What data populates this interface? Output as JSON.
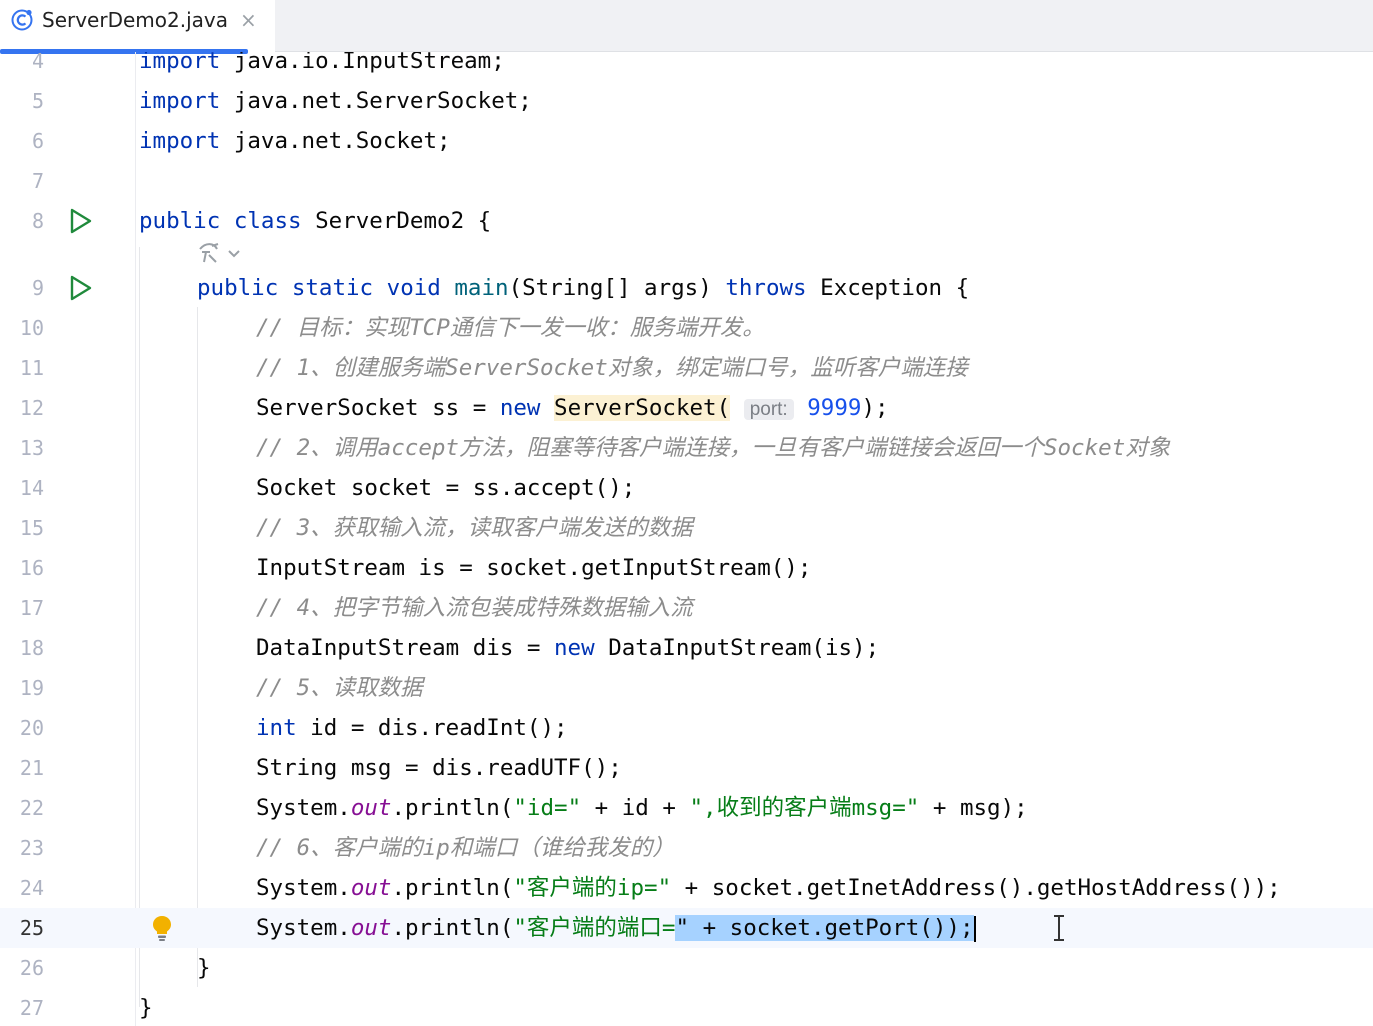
{
  "tab": {
    "title": "ServerDemo2.java",
    "close": "×"
  },
  "colors": {
    "accent": "#3574f0",
    "keyword": "#0033b3",
    "string": "#067d17",
    "comment": "#8c8c8c",
    "field": "#871094",
    "selection": "#a6d2ff"
  },
  "lines": [
    {
      "n": "4"
    },
    {
      "n": "5"
    },
    {
      "n": "6"
    },
    {
      "n": "7"
    },
    {
      "n": "8"
    },
    {
      "n": "9"
    },
    {
      "n": "10"
    },
    {
      "n": "11"
    },
    {
      "n": "12"
    },
    {
      "n": "13"
    },
    {
      "n": "14"
    },
    {
      "n": "15"
    },
    {
      "n": "16"
    },
    {
      "n": "17"
    },
    {
      "n": "18"
    },
    {
      "n": "19"
    },
    {
      "n": "20"
    },
    {
      "n": "21"
    },
    {
      "n": "22"
    },
    {
      "n": "23"
    },
    {
      "n": "24"
    },
    {
      "n": "25"
    },
    {
      "n": "26"
    },
    {
      "n": "27"
    }
  ],
  "code": {
    "l4": {
      "kw": "import",
      "rest": " java.io.InputStream;"
    },
    "l5": {
      "kw": "import",
      "rest": " java.net.ServerSocket;"
    },
    "l6": {
      "kw": "import",
      "rest": " java.net.Socket;"
    },
    "l8": {
      "kw1": "public",
      "kw2": "class",
      "rest": " ServerDemo2 {"
    },
    "l9": {
      "kw1": "public",
      "kw2": "static",
      "kw3": "void",
      "name": "main",
      "args": "(String[] args) ",
      "kw4": "throws",
      "rest": " Exception {"
    },
    "l10": "// 目标：实现TCP通信下一发一收：服务端开发。",
    "l11": "// 1、创建服务端ServerSocket对象，绑定端口号，监听客户端连接",
    "l12": {
      "a": "ServerSocket ss = ",
      "kw": "new",
      "cls": "ServerSocket",
      "paren": "(",
      "hint": "port:",
      "num": "9999",
      "end": ");"
    },
    "l13": "// 2、调用accept方法，阻塞等待客户端连接，一旦有客户端链接会返回一个Socket对象",
    "l14": "Socket socket = ss.accept();",
    "l15": "// 3、获取输入流，读取客户端发送的数据",
    "l16": "InputStream is = socket.getInputStream();",
    "l17": "// 4、把字节输入流包装成特殊数据输入流",
    "l18": {
      "a": "DataInputStream dis = ",
      "kw": "new",
      "rest": " DataInputStream(is);"
    },
    "l19": "// 5、读取数据",
    "l20": {
      "kw": "int",
      "rest": " id = dis.readInt();"
    },
    "l21": "String msg = dis.readUTF();",
    "l22": {
      "a": "System.",
      "fld": "out",
      "b": ".println(",
      "s1": "\"id=\"",
      "c": " + id + ",
      "s2": "\",收到的客户端msg=\"",
      "d": " + msg);"
    },
    "l23": "// 6、客户端的ip和端口（谁给我发的）",
    "l24": {
      "a": "System.",
      "fld": "out",
      "b": ".println(",
      "s1": "\"客户端的ip=",
      "s2": "\"",
      "d": " + socket.getInetAddress().getHostAddress());"
    },
    "l25": {
      "a": "System.",
      "fld": "out",
      "b": ".println(",
      "s1": "\"客户端的端口=",
      "sel": "\" + socket.getPort());"
    },
    "l26": "}",
    "l27": "}"
  }
}
